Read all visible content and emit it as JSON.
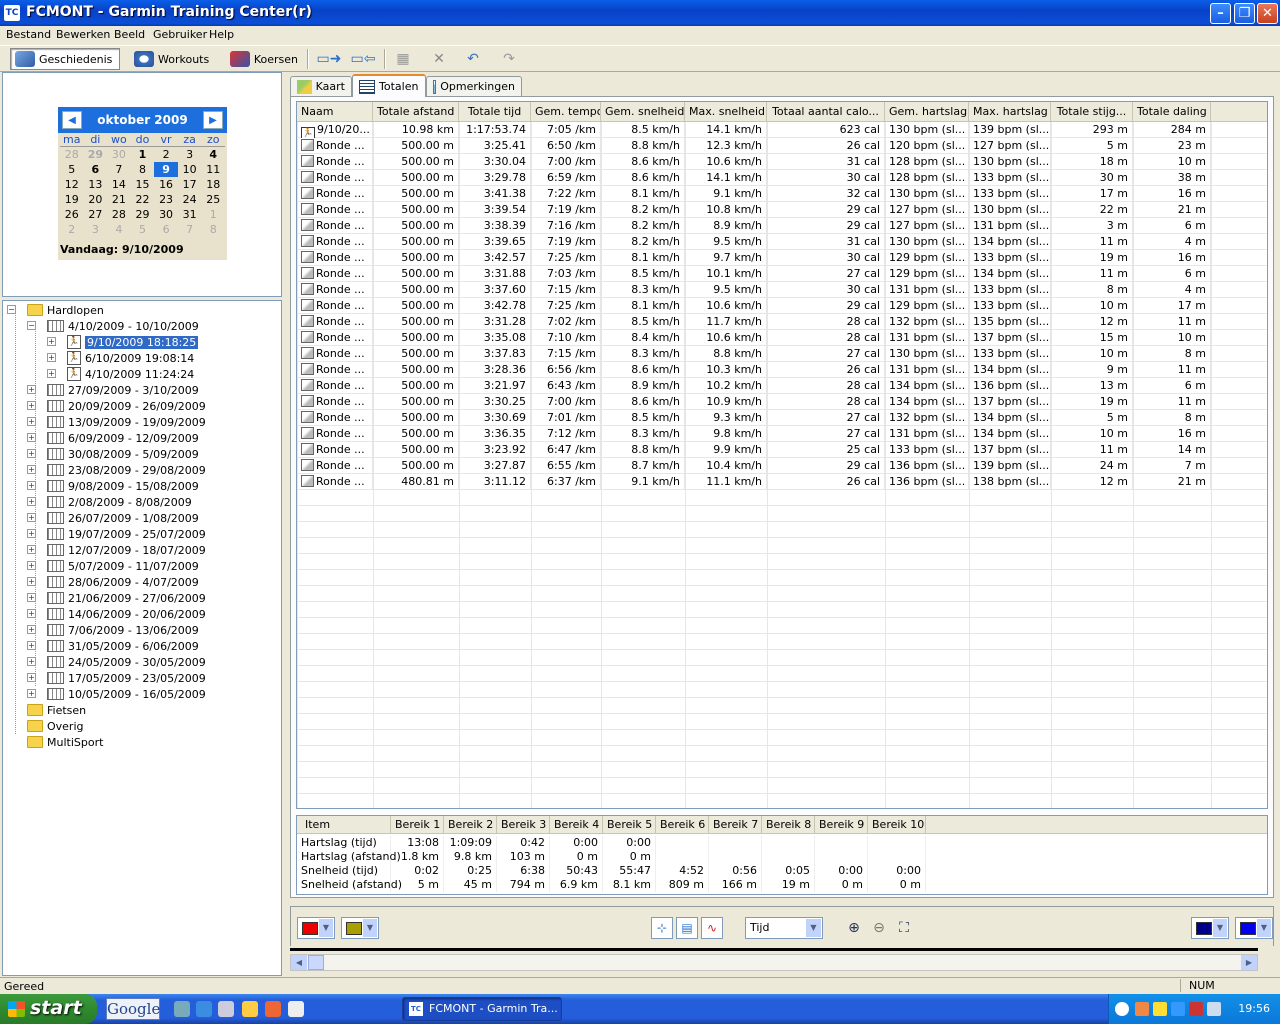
{
  "window": {
    "title": "FCMONT - Garmin Training Center(r)",
    "app_icon": "TC"
  },
  "menu": [
    "Bestand",
    "Bewerken",
    "Beeld",
    "Gebruiker",
    "Help"
  ],
  "toolbar": {
    "history": "Geschiedenis",
    "workouts": "Workouts",
    "courses": "Koersen"
  },
  "calendar": {
    "month": "oktober 2009",
    "prev": "<",
    "next": ">",
    "dow": [
      "ma",
      "di",
      "wo",
      "do",
      "vr",
      "za",
      "zo"
    ],
    "days": [
      [
        "28",
        "o"
      ],
      [
        "29",
        "ob"
      ],
      [
        "30",
        "o"
      ],
      [
        "1",
        "b"
      ],
      [
        "2",
        ""
      ],
      [
        "3",
        ""
      ],
      [
        "4",
        "b"
      ],
      [
        "5",
        ""
      ],
      [
        "6",
        "b"
      ],
      [
        "7",
        ""
      ],
      [
        "8",
        ""
      ],
      [
        "9",
        "s"
      ],
      [
        "10",
        ""
      ],
      [
        "11",
        ""
      ],
      [
        "12",
        ""
      ],
      [
        "13",
        ""
      ],
      [
        "14",
        ""
      ],
      [
        "15",
        ""
      ],
      [
        "16",
        ""
      ],
      [
        "17",
        ""
      ],
      [
        "18",
        ""
      ],
      [
        "19",
        ""
      ],
      [
        "20",
        ""
      ],
      [
        "21",
        ""
      ],
      [
        "22",
        ""
      ],
      [
        "23",
        ""
      ],
      [
        "24",
        ""
      ],
      [
        "25",
        ""
      ],
      [
        "26",
        ""
      ],
      [
        "27",
        ""
      ],
      [
        "28",
        ""
      ],
      [
        "29",
        ""
      ],
      [
        "30",
        ""
      ],
      [
        "31",
        ""
      ],
      [
        "1",
        "o"
      ],
      [
        "2",
        "o"
      ],
      [
        "3",
        "o"
      ],
      [
        "4",
        "o"
      ],
      [
        "5",
        "o"
      ],
      [
        "6",
        "o"
      ],
      [
        "7",
        "o"
      ],
      [
        "8",
        "o"
      ]
    ],
    "today": "Vandaag: 9/10/2009"
  },
  "tree": {
    "root": "Hardlopen",
    "open_week": "4/10/2009 - 10/10/2009",
    "activities": [
      "9/10/2009 18:18:25",
      "6/10/2009 19:08:14",
      "4/10/2009 11:24:24"
    ],
    "weeks": [
      "27/09/2009 - 3/10/2009",
      "20/09/2009 - 26/09/2009",
      "13/09/2009 - 19/09/2009",
      "6/09/2009 - 12/09/2009",
      "30/08/2009 - 5/09/2009",
      "23/08/2009 - 29/08/2009",
      "9/08/2009 - 15/08/2009",
      "2/08/2009 - 8/08/2009",
      "26/07/2009 - 1/08/2009",
      "19/07/2009 - 25/07/2009",
      "12/07/2009 - 18/07/2009",
      "5/07/2009 - 11/07/2009",
      "28/06/2009 - 4/07/2009",
      "21/06/2009 - 27/06/2009",
      "14/06/2009 - 20/06/2009",
      "7/06/2009 - 13/06/2009",
      "31/05/2009 - 6/06/2009",
      "24/05/2009 - 30/05/2009",
      "17/05/2009 - 23/05/2009",
      "10/05/2009 - 16/05/2009"
    ],
    "other_folders": [
      "Fietsen",
      "Overig",
      "MultiSport"
    ]
  },
  "tabs": [
    "Kaart",
    "Totalen",
    "Opmerkingen"
  ],
  "totals": {
    "columns": [
      "Naam",
      "Totale afstand",
      "Totale tijd",
      "Gem. tempo",
      "Gem. snelheid",
      "Max. snelheid",
      "Totaal aantal calo...",
      "Gem. hartslag",
      "Max. hartslag",
      "Totale stijg...",
      "Totale daling"
    ],
    "rows": [
      [
        "9/10/20...",
        "10.98 km",
        "1:17:53.74",
        "7:05 /km",
        "8.5 km/h",
        "14.1 km/h",
        "623 cal",
        "130 bpm (sl...",
        "139 bpm (sl...",
        "293 m",
        "284 m"
      ],
      [
        "Ronde ...",
        "500.00 m",
        "3:25.41",
        "6:50 /km",
        "8.8 km/h",
        "12.3 km/h",
        "26 cal",
        "120 bpm (sl...",
        "127 bpm (sl...",
        "5 m",
        "23 m"
      ],
      [
        "Ronde ...",
        "500.00 m",
        "3:30.04",
        "7:00 /km",
        "8.6 km/h",
        "10.6 km/h",
        "31 cal",
        "128 bpm (sl...",
        "130 bpm (sl...",
        "18 m",
        "10 m"
      ],
      [
        "Ronde ...",
        "500.00 m",
        "3:29.78",
        "6:59 /km",
        "8.6 km/h",
        "14.1 km/h",
        "30 cal",
        "128 bpm (sl...",
        "133 bpm (sl...",
        "30 m",
        "38 m"
      ],
      [
        "Ronde ...",
        "500.00 m",
        "3:41.38",
        "7:22 /km",
        "8.1 km/h",
        "9.1 km/h",
        "32 cal",
        "130 bpm (sl...",
        "133 bpm (sl...",
        "17 m",
        "16 m"
      ],
      [
        "Ronde ...",
        "500.00 m",
        "3:39.54",
        "7:19 /km",
        "8.2 km/h",
        "10.8 km/h",
        "29 cal",
        "127 bpm (sl...",
        "130 bpm (sl...",
        "22 m",
        "21 m"
      ],
      [
        "Ronde ...",
        "500.00 m",
        "3:38.39",
        "7:16 /km",
        "8.2 km/h",
        "8.9 km/h",
        "29 cal",
        "127 bpm (sl...",
        "131 bpm (sl...",
        "3 m",
        "6 m"
      ],
      [
        "Ronde ...",
        "500.00 m",
        "3:39.65",
        "7:19 /km",
        "8.2 km/h",
        "9.5 km/h",
        "31 cal",
        "130 bpm (sl...",
        "134 bpm (sl...",
        "11 m",
        "4 m"
      ],
      [
        "Ronde ...",
        "500.00 m",
        "3:42.57",
        "7:25 /km",
        "8.1 km/h",
        "9.7 km/h",
        "30 cal",
        "129 bpm (sl...",
        "133 bpm (sl...",
        "19 m",
        "16 m"
      ],
      [
        "Ronde ...",
        "500.00 m",
        "3:31.88",
        "7:03 /km",
        "8.5 km/h",
        "10.1 km/h",
        "27 cal",
        "129 bpm (sl...",
        "134 bpm (sl...",
        "11 m",
        "6 m"
      ],
      [
        "Ronde ...",
        "500.00 m",
        "3:37.60",
        "7:15 /km",
        "8.3 km/h",
        "9.5 km/h",
        "30 cal",
        "131 bpm (sl...",
        "133 bpm (sl...",
        "8 m",
        "4 m"
      ],
      [
        "Ronde ...",
        "500.00 m",
        "3:42.78",
        "7:25 /km",
        "8.1 km/h",
        "10.6 km/h",
        "29 cal",
        "129 bpm (sl...",
        "133 bpm (sl...",
        "10 m",
        "17 m"
      ],
      [
        "Ronde ...",
        "500.00 m",
        "3:31.28",
        "7:02 /km",
        "8.5 km/h",
        "11.7 km/h",
        "28 cal",
        "132 bpm (sl...",
        "135 bpm (sl...",
        "12 m",
        "11 m"
      ],
      [
        "Ronde ...",
        "500.00 m",
        "3:35.08",
        "7:10 /km",
        "8.4 km/h",
        "10.6 km/h",
        "28 cal",
        "131 bpm (sl...",
        "137 bpm (sl...",
        "15 m",
        "10 m"
      ],
      [
        "Ronde ...",
        "500.00 m",
        "3:37.83",
        "7:15 /km",
        "8.3 km/h",
        "8.8 km/h",
        "27 cal",
        "130 bpm (sl...",
        "133 bpm (sl...",
        "10 m",
        "8 m"
      ],
      [
        "Ronde ...",
        "500.00 m",
        "3:28.36",
        "6:56 /km",
        "8.6 km/h",
        "10.3 km/h",
        "26 cal",
        "131 bpm (sl...",
        "134 bpm (sl...",
        "9 m",
        "11 m"
      ],
      [
        "Ronde ...",
        "500.00 m",
        "3:21.97",
        "6:43 /km",
        "8.9 km/h",
        "10.2 km/h",
        "28 cal",
        "134 bpm (sl...",
        "136 bpm (sl...",
        "13 m",
        "6 m"
      ],
      [
        "Ronde ...",
        "500.00 m",
        "3:30.25",
        "7:00 /km",
        "8.6 km/h",
        "10.9 km/h",
        "28 cal",
        "134 bpm (sl...",
        "137 bpm (sl...",
        "19 m",
        "11 m"
      ],
      [
        "Ronde ...",
        "500.00 m",
        "3:30.69",
        "7:01 /km",
        "8.5 km/h",
        "9.3 km/h",
        "27 cal",
        "132 bpm (sl...",
        "134 bpm (sl...",
        "5 m",
        "8 m"
      ],
      [
        "Ronde ...",
        "500.00 m",
        "3:36.35",
        "7:12 /km",
        "8.3 km/h",
        "9.8 km/h",
        "27 cal",
        "131 bpm (sl...",
        "134 bpm (sl...",
        "10 m",
        "16 m"
      ],
      [
        "Ronde ...",
        "500.00 m",
        "3:23.92",
        "6:47 /km",
        "8.8 km/h",
        "9.9 km/h",
        "25 cal",
        "133 bpm (sl...",
        "137 bpm (sl...",
        "11 m",
        "14 m"
      ],
      [
        "Ronde ...",
        "500.00 m",
        "3:27.87",
        "6:55 /km",
        "8.7 km/h",
        "10.4 km/h",
        "29 cal",
        "136 bpm (sl...",
        "139 bpm (sl...",
        "24 m",
        "7 m"
      ],
      [
        "Ronde ...",
        "480.81 m",
        "3:11.12",
        "6:37 /km",
        "9.1 km/h",
        "11.1 km/h",
        "26 cal",
        "136 bpm (sl...",
        "138 bpm (sl...",
        "12 m",
        "21 m"
      ]
    ]
  },
  "zones": {
    "columns": [
      "Item",
      "Bereik 1",
      "Bereik 2",
      "Bereik 3",
      "Bereik 4",
      "Bereik 5",
      "Bereik 6",
      "Bereik 7",
      "Bereik 8",
      "Bereik 9",
      "Bereik 10"
    ],
    "rows": [
      [
        "Hartslag (tijd)",
        "13:08",
        "1:09:09",
        "0:42",
        "0:00",
        "0:00",
        "",
        "",
        "",
        "",
        ""
      ],
      [
        "Hartslag (afstand)",
        "1.8 km",
        "9.8 km",
        "103 m",
        "0 m",
        "0 m",
        "",
        "",
        "",
        "",
        ""
      ],
      [
        "Snelheid (tijd)",
        "0:02",
        "0:25",
        "6:38",
        "50:43",
        "55:47",
        "4:52",
        "0:56",
        "0:05",
        "0:00",
        "0:00"
      ],
      [
        "Snelheid (afstand)",
        "5 m",
        "45 m",
        "794 m",
        "6.9 km",
        "8.1 km",
        "809 m",
        "166 m",
        "19 m",
        "0 m",
        "0 m"
      ]
    ]
  },
  "graph": {
    "axis_select": "Tijd",
    "color1": "#ee0000",
    "color2": "#a8a000",
    "color3": "#00008b",
    "color4": "#0000ee"
  },
  "status": {
    "text": "Gereed",
    "num": "NUM"
  },
  "taskbar": {
    "start": "start",
    "google": "Google",
    "task": "FCMONT - Garmin Tra...",
    "clock": "19:56"
  }
}
